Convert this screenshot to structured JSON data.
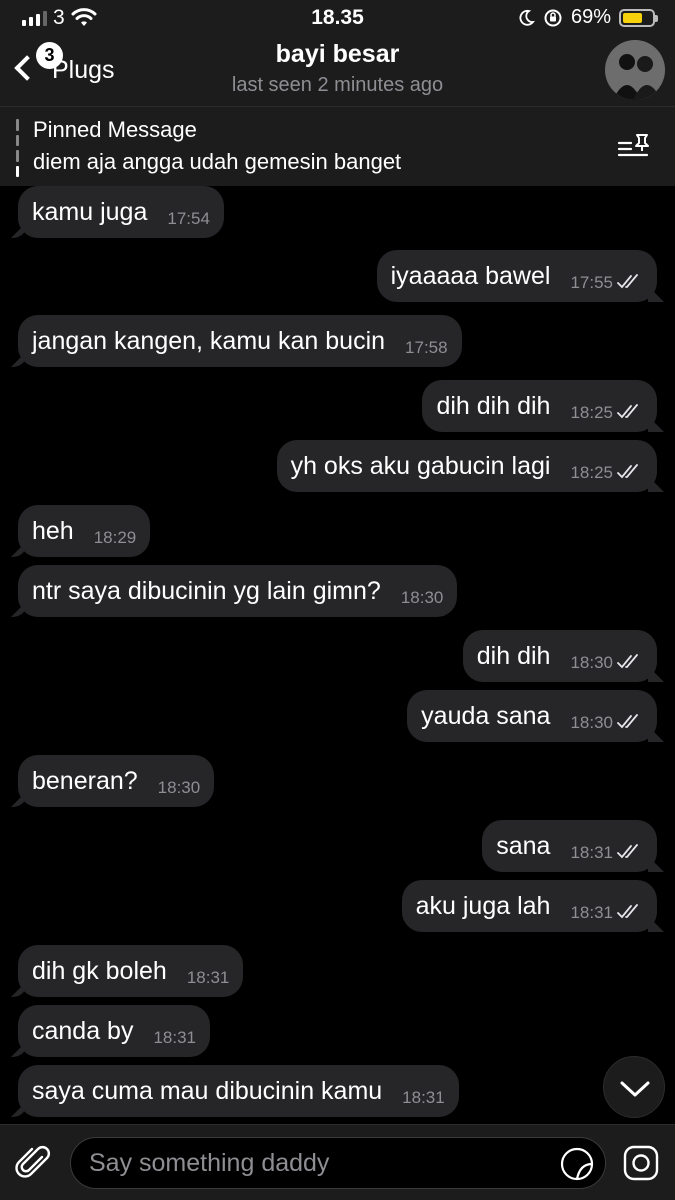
{
  "status_bar": {
    "time": "18.35",
    "carrier": "3",
    "battery": "69%",
    "battery_level": 0.69
  },
  "header": {
    "back_label": "Plugs",
    "unread_badge": "3",
    "title": "bayi besar",
    "subtitle": "last seen 2 minutes ago"
  },
  "pinned": {
    "title": "Pinned Message",
    "text": "diem aja angga udah gemesin banget"
  },
  "messages": [
    {
      "dir": "in",
      "text": "kamu juga",
      "time": "17:54"
    },
    {
      "dir": "out",
      "text": "iyaaaaa bawel",
      "time": "17:55"
    },
    {
      "dir": "in",
      "text": "jangan kangen, kamu kan bucin",
      "time": "17:58"
    },
    {
      "dir": "out",
      "text": "dih dih dih",
      "time": "18:25"
    },
    {
      "dir": "out",
      "text": "yh oks aku gabucin lagi",
      "time": "18:25"
    },
    {
      "dir": "in",
      "text": "heh",
      "time": "18:29"
    },
    {
      "dir": "in",
      "text": "ntr saya dibucinin yg lain gimn?",
      "time": "18:30"
    },
    {
      "dir": "out",
      "text": "dih dih",
      "time": "18:30"
    },
    {
      "dir": "out",
      "text": "yauda sana",
      "time": "18:30"
    },
    {
      "dir": "in",
      "text": "beneran?",
      "time": "18:30"
    },
    {
      "dir": "out",
      "text": "sana",
      "time": "18:31"
    },
    {
      "dir": "out",
      "text": "aku juga lah",
      "time": "18:31"
    },
    {
      "dir": "in",
      "text": "dih gk boleh",
      "time": "18:31"
    },
    {
      "dir": "in",
      "text": "canda by",
      "time": "18:31"
    },
    {
      "dir": "in",
      "text": "saya cuma mau dibucinin kamu",
      "time": "18:31"
    }
  ],
  "composer": {
    "placeholder": "Say something daddy"
  },
  "colors": {
    "bubble": "#262628",
    "bar": "#1c1c1d",
    "battery": "#f5d20c"
  }
}
